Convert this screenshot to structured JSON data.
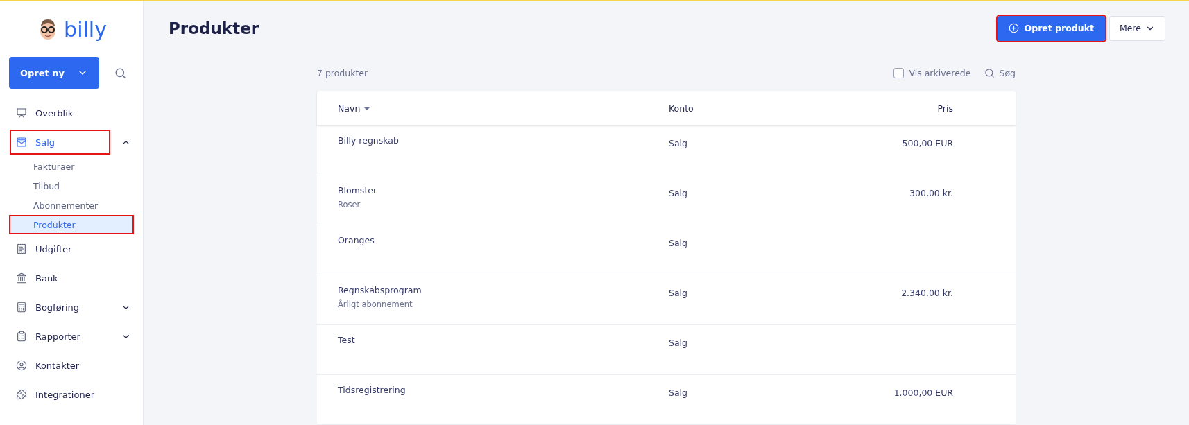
{
  "sidebar": {
    "logo": "billy",
    "create_button": "Opret ny",
    "items": [
      {
        "label": "Overblik",
        "selected": false,
        "highlighted": false
      },
      {
        "label": "Salg",
        "selected": true,
        "highlighted": true,
        "expanded": true,
        "children": [
          {
            "label": "Fakturaer",
            "selected": false,
            "highlighted": false
          },
          {
            "label": "Tilbud",
            "selected": false,
            "highlighted": false
          },
          {
            "label": "Abonnementer",
            "selected": false,
            "highlighted": false
          },
          {
            "label": "Produkter",
            "selected": true,
            "highlighted": true
          }
        ]
      },
      {
        "label": "Udgifter",
        "selected": false,
        "highlighted": false
      },
      {
        "label": "Bank",
        "selected": false,
        "highlighted": false
      },
      {
        "label": "Bogføring",
        "selected": false,
        "highlighted": false,
        "expanded": false
      },
      {
        "label": "Rapporter",
        "selected": false,
        "highlighted": false,
        "expanded": false
      },
      {
        "label": "Kontakter",
        "selected": false,
        "highlighted": false
      },
      {
        "label": "Integrationer",
        "selected": false,
        "highlighted": false
      }
    ]
  },
  "header": {
    "title": "Produkter",
    "primary_button": {
      "label": "Opret produkt",
      "highlighted": true
    },
    "more_button": "Mere"
  },
  "toolbar": {
    "count": "7 produkter",
    "show_archived": {
      "label": "Vis arkiverede",
      "checked": false
    },
    "search": "Søg"
  },
  "table": {
    "columns": [
      "Navn",
      "Konto",
      "Pris"
    ],
    "rows": [
      {
        "name": "Billy regnskab",
        "account": "Salg",
        "price": "500,00 EUR"
      },
      {
        "name": "Blomster",
        "description": "Roser",
        "account": "Salg",
        "price": "300,00 kr."
      },
      {
        "name": "Oranges",
        "account": "Salg"
      },
      {
        "name": "Regnskabsprogram",
        "description": "Årligt abonnement",
        "account": "Salg",
        "price": "2.340,00 kr."
      },
      {
        "name": "Test",
        "account": "Salg"
      },
      {
        "name": "Tidsregistrering",
        "account": "Salg",
        "price": "1.000,00 EUR"
      }
    ]
  }
}
